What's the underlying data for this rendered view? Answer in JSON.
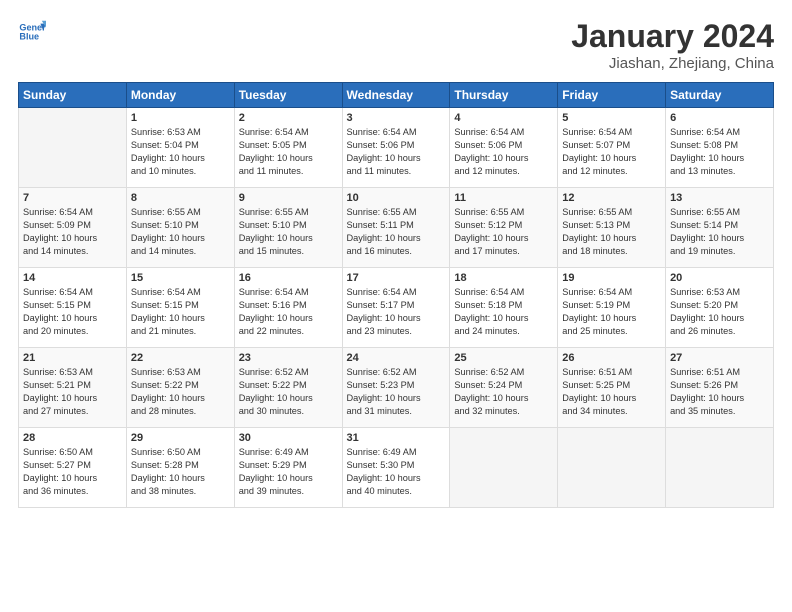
{
  "logo": {
    "line1": "General",
    "line2": "Blue"
  },
  "title": "January 2024",
  "subtitle": "Jiashan, Zhejiang, China",
  "weekdays": [
    "Sunday",
    "Monday",
    "Tuesday",
    "Wednesday",
    "Thursday",
    "Friday",
    "Saturday"
  ],
  "weeks": [
    [
      {
        "day": "",
        "empty": true
      },
      {
        "day": "1",
        "sunrise": "6:53 AM",
        "sunset": "5:04 PM",
        "daylight": "10 hours and 10 minutes."
      },
      {
        "day": "2",
        "sunrise": "6:54 AM",
        "sunset": "5:05 PM",
        "daylight": "10 hours and 11 minutes."
      },
      {
        "day": "3",
        "sunrise": "6:54 AM",
        "sunset": "5:06 PM",
        "daylight": "10 hours and 11 minutes."
      },
      {
        "day": "4",
        "sunrise": "6:54 AM",
        "sunset": "5:06 PM",
        "daylight": "10 hours and 12 minutes."
      },
      {
        "day": "5",
        "sunrise": "6:54 AM",
        "sunset": "5:07 PM",
        "daylight": "10 hours and 12 minutes."
      },
      {
        "day": "6",
        "sunrise": "6:54 AM",
        "sunset": "5:08 PM",
        "daylight": "10 hours and 13 minutes."
      }
    ],
    [
      {
        "day": "7",
        "sunrise": "6:54 AM",
        "sunset": "5:09 PM",
        "daylight": "10 hours and 14 minutes."
      },
      {
        "day": "8",
        "sunrise": "6:55 AM",
        "sunset": "5:10 PM",
        "daylight": "10 hours and 14 minutes."
      },
      {
        "day": "9",
        "sunrise": "6:55 AM",
        "sunset": "5:10 PM",
        "daylight": "10 hours and 15 minutes."
      },
      {
        "day": "10",
        "sunrise": "6:55 AM",
        "sunset": "5:11 PM",
        "daylight": "10 hours and 16 minutes."
      },
      {
        "day": "11",
        "sunrise": "6:55 AM",
        "sunset": "5:12 PM",
        "daylight": "10 hours and 17 minutes."
      },
      {
        "day": "12",
        "sunrise": "6:55 AM",
        "sunset": "5:13 PM",
        "daylight": "10 hours and 18 minutes."
      },
      {
        "day": "13",
        "sunrise": "6:55 AM",
        "sunset": "5:14 PM",
        "daylight": "10 hours and 19 minutes."
      }
    ],
    [
      {
        "day": "14",
        "sunrise": "6:54 AM",
        "sunset": "5:15 PM",
        "daylight": "10 hours and 20 minutes."
      },
      {
        "day": "15",
        "sunrise": "6:54 AM",
        "sunset": "5:15 PM",
        "daylight": "10 hours and 21 minutes."
      },
      {
        "day": "16",
        "sunrise": "6:54 AM",
        "sunset": "5:16 PM",
        "daylight": "10 hours and 22 minutes."
      },
      {
        "day": "17",
        "sunrise": "6:54 AM",
        "sunset": "5:17 PM",
        "daylight": "10 hours and 23 minutes."
      },
      {
        "day": "18",
        "sunrise": "6:54 AM",
        "sunset": "5:18 PM",
        "daylight": "10 hours and 24 minutes."
      },
      {
        "day": "19",
        "sunrise": "6:54 AM",
        "sunset": "5:19 PM",
        "daylight": "10 hours and 25 minutes."
      },
      {
        "day": "20",
        "sunrise": "6:53 AM",
        "sunset": "5:20 PM",
        "daylight": "10 hours and 26 minutes."
      }
    ],
    [
      {
        "day": "21",
        "sunrise": "6:53 AM",
        "sunset": "5:21 PM",
        "daylight": "10 hours and 27 minutes."
      },
      {
        "day": "22",
        "sunrise": "6:53 AM",
        "sunset": "5:22 PM",
        "daylight": "10 hours and 28 minutes."
      },
      {
        "day": "23",
        "sunrise": "6:52 AM",
        "sunset": "5:22 PM",
        "daylight": "10 hours and 30 minutes."
      },
      {
        "day": "24",
        "sunrise": "6:52 AM",
        "sunset": "5:23 PM",
        "daylight": "10 hours and 31 minutes."
      },
      {
        "day": "25",
        "sunrise": "6:52 AM",
        "sunset": "5:24 PM",
        "daylight": "10 hours and 32 minutes."
      },
      {
        "day": "26",
        "sunrise": "6:51 AM",
        "sunset": "5:25 PM",
        "daylight": "10 hours and 34 minutes."
      },
      {
        "day": "27",
        "sunrise": "6:51 AM",
        "sunset": "5:26 PM",
        "daylight": "10 hours and 35 minutes."
      }
    ],
    [
      {
        "day": "28",
        "sunrise": "6:50 AM",
        "sunset": "5:27 PM",
        "daylight": "10 hours and 36 minutes."
      },
      {
        "day": "29",
        "sunrise": "6:50 AM",
        "sunset": "5:28 PM",
        "daylight": "10 hours and 38 minutes."
      },
      {
        "day": "30",
        "sunrise": "6:49 AM",
        "sunset": "5:29 PM",
        "daylight": "10 hours and 39 minutes."
      },
      {
        "day": "31",
        "sunrise": "6:49 AM",
        "sunset": "5:30 PM",
        "daylight": "10 hours and 40 minutes."
      },
      {
        "day": "",
        "empty": true
      },
      {
        "day": "",
        "empty": true
      },
      {
        "day": "",
        "empty": true
      }
    ]
  ],
  "labels": {
    "sunrise_prefix": "Sunrise: ",
    "sunset_prefix": "Sunset: ",
    "daylight_prefix": "Daylight: "
  }
}
